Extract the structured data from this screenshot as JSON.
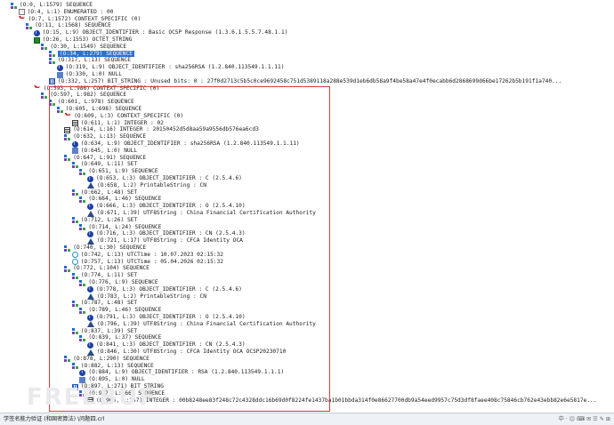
{
  "tree": {
    "nodes": [
      {
        "icon": "seq",
        "toggle": "-",
        "text": "(O:0, L:1579) SEQUENCE"
      },
      {
        "icon": "enum",
        "toggle": "",
        "text": "(O:4, L:1) ENUMERATED : 00"
      },
      {
        "icon": "ctx",
        "toggle": "-",
        "text": "(O:7, L:1572) CONTEXT_SPECIFIC (0)"
      },
      {
        "icon": "seq",
        "toggle": "-",
        "text": "(O:11, L:1568) SEQUENCE"
      },
      {
        "icon": "oid",
        "toggle": "",
        "text": "(O:15, L:9) OBJECT_IDENTIFIER : Basic OCSP Response (1.3.6.1.5.5.7.48.1.1)"
      },
      {
        "icon": "octet",
        "toggle": "-",
        "text": "(O:26, L:1553) OCTET_STRING"
      },
      {
        "icon": "seq",
        "toggle": "-",
        "text": "(O:30, L:1549) SEQUENCE"
      },
      {
        "icon": "seq",
        "toggle": "+",
        "text": "(O:34, L:279) SEQUENCE",
        "selected": true
      },
      {
        "icon": "seq",
        "toggle": "-",
        "text": "(O:317, L:13) SEQUENCE"
      },
      {
        "icon": "oid",
        "toggle": "",
        "text": "(O:319, L:9) OBJECT_IDENTIFIER : sha256RSA (1.2.840.113549.1.1.11)"
      },
      {
        "icon": "nul",
        "toggle": "",
        "text": "(O:330, L:0) NULL"
      },
      {
        "icon": "bits",
        "toggle": "",
        "text": "(O:332, L:257) BIT_STRING : Unused bits: 0 : 27f0d2713c5b5c0ce9692458c751d5389118a288e539d1eb6db58a9f4be58a47e4f0ecabb6d2868699d66be17262b5b191f1a740..."
      },
      {
        "icon": "ctx",
        "toggle": "-",
        "text": "(O:593, L:986) CONTEXT_SPECIFIC (0)"
      },
      {
        "icon": "seq",
        "toggle": "-",
        "text": "(O:597, L:982) SEQUENCE"
      },
      {
        "icon": "seq",
        "toggle": "-",
        "text": "(O:601, L:978) SEQUENCE"
      },
      {
        "icon": "seq",
        "toggle": "-",
        "text": "(O:605, L:698) SEQUENCE"
      },
      {
        "icon": "ctx",
        "toggle": "-",
        "text": "(O:609, L:3) CONTEXT_SPECIFIC (0)"
      },
      {
        "icon": "int",
        "toggle": "",
        "text": "(O:611, L:1) INTEGER : 02"
      },
      {
        "icon": "int",
        "toggle": "",
        "text": "(O:614, L:16) INTEGER : 20150452d5d8aa59a9556db576ea6cd3"
      },
      {
        "icon": "seq",
        "toggle": "-",
        "text": "(O:632, L:13) SEQUENCE"
      },
      {
        "icon": "oid",
        "toggle": "",
        "text": "(O:634, L:9) OBJECT_IDENTIFIER : sha256RSA (1.2.840.113549.1.1.11)"
      },
      {
        "icon": "nul",
        "toggle": "",
        "text": "(O:645, L:0) NULL"
      },
      {
        "icon": "seq",
        "toggle": "-",
        "text": "(O:647, L:91) SEQUENCE"
      },
      {
        "icon": "seq",
        "toggle": "-",
        "text": "(O:649, L:11) SET"
      },
      {
        "icon": "seq",
        "toggle": "-",
        "text": "(O:651, L:9) SEQUENCE"
      },
      {
        "icon": "oid",
        "toggle": "",
        "text": "(O:653, L:3) OBJECT_IDENTIFIER : C (2.5.4.6)"
      },
      {
        "icon": "str",
        "toggle": "",
        "text": "(O:658, L:2) PrintableString : CN"
      },
      {
        "icon": "seq",
        "toggle": "-",
        "text": "(O:662, L:48) SET"
      },
      {
        "icon": "seq",
        "toggle": "-",
        "text": "(O:664, L:46) SEQUENCE"
      },
      {
        "icon": "oid",
        "toggle": "",
        "text": "(O:666, L:3) OBJECT_IDENTIFIER : O (2.5.4.10)"
      },
      {
        "icon": "str",
        "toggle": "",
        "text": "(O:671, L:39) UTF8String : China Financial Certification Authority"
      },
      {
        "icon": "seq",
        "toggle": "-",
        "text": "(O:712, L:26) SET"
      },
      {
        "icon": "seq",
        "toggle": "-",
        "text": "(O:714, L:24) SEQUENCE"
      },
      {
        "icon": "oid",
        "toggle": "",
        "text": "(O:716, L:3) OBJECT_IDENTIFIER : CN (2.5.4.3)"
      },
      {
        "icon": "str",
        "toggle": "",
        "text": "(O:721, L:17) UTF8String : CFCA Identity OCA"
      },
      {
        "icon": "seq",
        "toggle": "-",
        "text": "(O:740, L:30) SEQUENCE"
      },
      {
        "icon": "time",
        "toggle": "",
        "text": "(O:742, L:13) UTCTime : 10.07.2023 02:15:32"
      },
      {
        "icon": "time",
        "toggle": "",
        "text": "(O:757, L:13) UTCTime : 05.04.2026 02:15:32"
      },
      {
        "icon": "seq",
        "toggle": "-",
        "text": "(O:772, L:104) SEQUENCE"
      },
      {
        "icon": "seq",
        "toggle": "-",
        "text": "(O:774, L:11) SET"
      },
      {
        "icon": "seq",
        "toggle": "-",
        "text": "(O:776, L:9) SEQUENCE"
      },
      {
        "icon": "oid",
        "toggle": "",
        "text": "(O:778, L:3) OBJECT_IDENTIFIER : C (2.5.4.6)"
      },
      {
        "icon": "str",
        "toggle": "",
        "text": "(O:783, L:2) PrintableString : CN"
      },
      {
        "icon": "seq",
        "toggle": "-",
        "text": "(O:787, L:48) SET"
      },
      {
        "icon": "seq",
        "toggle": "-",
        "text": "(O:789, L:46) SEQUENCE"
      },
      {
        "icon": "oid",
        "toggle": "",
        "text": "(O:791, L:3) OBJECT_IDENTIFIER : O (2.5.4.10)"
      },
      {
        "icon": "str",
        "toggle": "",
        "text": "(O:796, L:39) UTF8String : China Financial Certification Authority"
      },
      {
        "icon": "seq",
        "toggle": "-",
        "text": "(O:837, L:39) SET"
      },
      {
        "icon": "seq",
        "toggle": "-",
        "text": "(O:839, L:37) SEQUENCE"
      },
      {
        "icon": "oid",
        "toggle": "",
        "text": "(O:841, L:3) OBJECT_IDENTIFIER : CN (2.5.4.3)"
      },
      {
        "icon": "str",
        "toggle": "",
        "text": "(O:846, L:30) UTF8String : CFCA Identity OCA OCSP20230710"
      },
      {
        "icon": "seq",
        "toggle": "-",
        "text": "(O:878, L:290) SEQUENCE"
      },
      {
        "icon": "seq",
        "toggle": "-",
        "text": "(O:882, L:13) SEQUENCE"
      },
      {
        "icon": "oid",
        "toggle": "",
        "text": "(O:884, L:9) OBJECT_IDENTIFIER : RSA (1.2.840.113549.1.1.1)"
      },
      {
        "icon": "nul",
        "toggle": "",
        "text": "(O:895, L:0) NULL"
      },
      {
        "icon": "bits",
        "toggle": "-",
        "text": "(O:897, L:271) BIT_STRING"
      },
      {
        "icon": "seq",
        "toggle": "-",
        "text": "(O:902, L:266) SEQUENCE"
      },
      {
        "icon": "int",
        "toggle": "",
        "text": "(O:906, L:257) INTEGER : 00b8248ee83f248c72c4328ddc16b69d0f8224fe1437ba1b01bbda314f0e86627700db9a54eed9957c75d3df8faee408c75846cb762e43ebb82e6e5817e..."
      }
    ]
  },
  "statusbar": {
    "left": "学签名能力验证 (和国密算法) \\问题四.crl",
    "right": "中 · ☺ ⌨ ✉ ☰ ✎ ⊞"
  },
  "watermark": "FREEBUF"
}
